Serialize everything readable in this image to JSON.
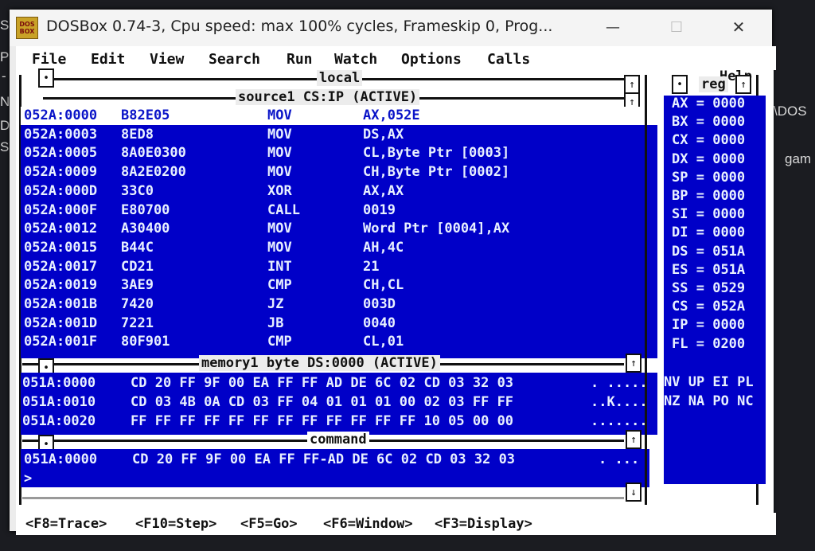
{
  "background": {
    "left_letters": [
      "S",
      "P",
      "-",
      "N",
      "D",
      "S"
    ],
    "right_texts": [
      "\\DOS",
      "gam"
    ]
  },
  "window": {
    "icon_text": [
      "DOS",
      "BOX"
    ],
    "title": "DOSBox 0.74-3, Cpu speed: max 100% cycles, Frameskip  0, Prog...",
    "minimize": "—",
    "maximize": "☐",
    "close": "✕"
  },
  "menu": [
    "File",
    "Edit",
    "View",
    "Search",
    "Run",
    "Watch",
    "Options",
    "Calls",
    "Help"
  ],
  "panels": {
    "local_title": "local",
    "source_title": "source1 CS:IP (ACTIVE)",
    "memory_title": "memory1 byte DS:0000 (ACTIVE)",
    "command_title": "command",
    "reg_title": "reg"
  },
  "source": [
    {
      "addr": "052A:0000",
      "bytes": "B82E05",
      "mn": "MOV",
      "ops": "AX,052E"
    },
    {
      "addr": "052A:0003",
      "bytes": "8ED8",
      "mn": "MOV",
      "ops": "DS,AX"
    },
    {
      "addr": "052A:0005",
      "bytes": "8A0E0300",
      "mn": "MOV",
      "ops": "CL,Byte Ptr [0003]"
    },
    {
      "addr": "052A:0009",
      "bytes": "8A2E0200",
      "mn": "MOV",
      "ops": "CH,Byte Ptr [0002]"
    },
    {
      "addr": "052A:000D",
      "bytes": "33C0",
      "mn": "XOR",
      "ops": "AX,AX"
    },
    {
      "addr": "052A:000F",
      "bytes": "E80700",
      "mn": "CALL",
      "ops": "0019"
    },
    {
      "addr": "052A:0012",
      "bytes": "A30400",
      "mn": "MOV",
      "ops": "Word Ptr [0004],AX"
    },
    {
      "addr": "052A:0015",
      "bytes": "B44C",
      "mn": "MOV",
      "ops": "AH,4C"
    },
    {
      "addr": "052A:0017",
      "bytes": "CD21",
      "mn": "INT",
      "ops": "21"
    },
    {
      "addr": "052A:0019",
      "bytes": "3AE9",
      "mn": "CMP",
      "ops": "CH,CL"
    },
    {
      "addr": "052A:001B",
      "bytes": "7420",
      "mn": "JZ",
      "ops": "003D"
    },
    {
      "addr": "052A:001D",
      "bytes": "7221",
      "mn": "JB",
      "ops": "0040"
    },
    {
      "addr": "052A:001F",
      "bytes": "80F901",
      "mn": "CMP",
      "ops": "CL,01"
    }
  ],
  "memory": [
    {
      "addr": "051A:0000",
      "hex": "CD 20 FF 9F 00 EA FF FF AD DE 6C 02 CD 03 32 03",
      "ascii": ". ....."
    },
    {
      "addr": "051A:0010",
      "hex": "CD 03 4B 0A CD 03 FF 04 01 01 01 00 02 03 FF FF",
      "ascii": "..K...."
    },
    {
      "addr": "051A:0020",
      "hex": "FF FF FF FF FF FF FF FF FF FF FF FF 10 05 00 00",
      "ascii": "......."
    }
  ],
  "command": {
    "line1_addr": "051A:0000",
    "line1_hex": "CD 20 FF 9F 00 EA FF FF-AD DE 6C 02 CD 03 32 03",
    "line1_ascii": ". ...",
    "prompt": ">"
  },
  "registers": [
    {
      "name": "AX",
      "val": "0000"
    },
    {
      "name": "BX",
      "val": "0000"
    },
    {
      "name": "CX",
      "val": "0000"
    },
    {
      "name": "DX",
      "val": "0000"
    },
    {
      "name": "SP",
      "val": "0000"
    },
    {
      "name": "BP",
      "val": "0000"
    },
    {
      "name": "SI",
      "val": "0000"
    },
    {
      "name": "DI",
      "val": "0000"
    },
    {
      "name": "DS",
      "val": "051A"
    },
    {
      "name": "ES",
      "val": "051A"
    },
    {
      "name": "SS",
      "val": "0529"
    },
    {
      "name": "CS",
      "val": "052A"
    },
    {
      "name": "IP",
      "val": "0000"
    },
    {
      "name": "FL",
      "val": "0200"
    }
  ],
  "flags": {
    "row1": "NV UP EI PL",
    "row2": "NZ NA PO NC"
  },
  "fkeys": [
    "<F8=Trace>",
    "<F10=Step>",
    "<F5=Go>",
    "<F6=Window>",
    "<F3=Display>"
  ],
  "colors": {
    "panel_blue": "#0000c8",
    "text": "#e8f0ff",
    "highlight": "#ffffff"
  }
}
